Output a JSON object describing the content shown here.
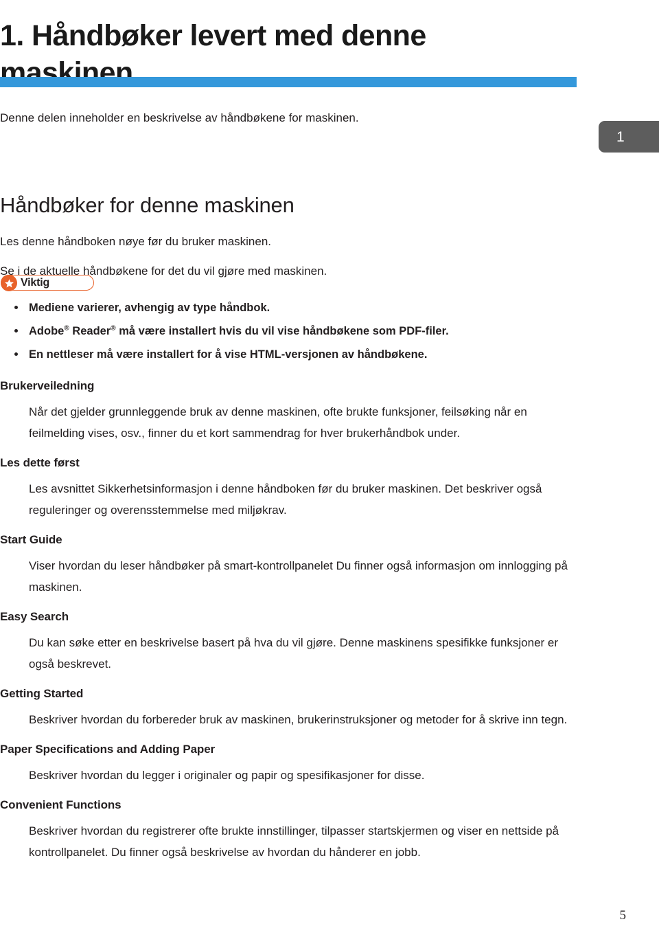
{
  "document": {
    "chapter_title": "1. Håndbøker levert med denne maskinen",
    "intro_line": "Denne delen inneholder en beskrivelse av håndbøkene for maskinen.",
    "section_heading": "Håndbøker for denne maskinen",
    "lead_paragraphs": [
      "Les denne håndboken nøye før du bruker maskinen.",
      "Se i de aktuelle håndbøkene for det du vil gjøre med maskinen."
    ],
    "page_tab_number": "1",
    "footer_page_number": "5"
  },
  "notice": {
    "label": "Viktig",
    "icon": "star-icon",
    "accent_color": "#e8622a"
  },
  "bullets": [
    {
      "text": "Mediene varierer, avhengig av type håndbok."
    },
    {
      "text_before": "Adobe",
      "sup1": "®",
      "text_mid": " Reader",
      "sup2": "®",
      "text_after": " må være installert hvis du vil vise håndbøkene som PDF-filer."
    },
    {
      "text": "En nettleser må være installert for å vise HTML-versjonen av håndbøkene."
    }
  ],
  "manual_entries": [
    {
      "title": "Brukerveiledning",
      "description": "Når det gjelder grunnleggende bruk av denne maskinen, ofte brukte funksjoner, feilsøking når en feilmelding vises, osv., finner du et kort sammendrag for hver brukerhåndbok under."
    },
    {
      "title": "Les dette først",
      "description": "Les avsnittet Sikkerhetsinformasjon i denne håndboken før du bruker maskinen. Det beskriver også reguleringer og overensstemmelse med miljøkrav."
    },
    {
      "title": "Start Guide",
      "description": "Viser hvordan du leser håndbøker på smart-kontrollpanelet Du finner også informasjon om innlogging på maskinen."
    },
    {
      "title": "Easy Search",
      "description": "Du kan søke etter en beskrivelse basert på hva du vil gjøre. Denne maskinens spesifikke funksjoner er også beskrevet."
    },
    {
      "title": "Getting Started",
      "description": "Beskriver hvordan du forbereder bruk av maskinen, brukerinstruksjoner og metoder for å skrive inn tegn."
    },
    {
      "title": "Paper Specifications and Adding Paper",
      "description": "Beskriver hvordan du legger i originaler og papir og spesifikasjoner for disse."
    },
    {
      "title": "Convenient Functions",
      "description": "Beskriver hvordan du registrerer ofte brukte innstillinger, tilpasser startskjermen og viser en nettside på kontrollpanelet. Du finner også beskrivelse av hvordan du hånderer en jobb."
    }
  ],
  "colors": {
    "rule_blue": "#3498db",
    "tab_gray": "#5d5d5d",
    "text": "#231f20"
  }
}
